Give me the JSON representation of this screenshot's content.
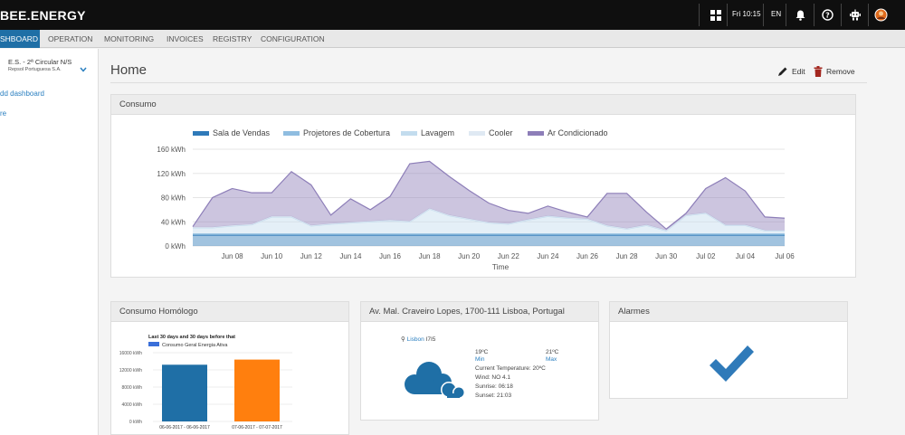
{
  "topbar": {
    "logo": "BEE.ENERGY",
    "datetime": "Fri 10:15",
    "language": "EN",
    "icons": [
      "apps-grid-icon",
      "bell-icon",
      "help-icon",
      "robot-icon",
      "user-avatar-icon"
    ]
  },
  "nav": {
    "items": [
      "DASHBOARD",
      "OPERATION",
      "MONITORING",
      "INVOICES",
      "REGISTRY",
      "CONFIGURATION"
    ],
    "active": "DASHBOARD",
    "dashboard_visible": "SHBOARD"
  },
  "sidebar": {
    "site_name": "E.S. - 2ª Circular N/S",
    "site_company": "Repsol Portuguesa S.A.",
    "add_dashboard": "dd dashboard",
    "more": "re"
  },
  "page": {
    "title": "Home",
    "edit_label": "Edit",
    "remove_label": "Remove"
  },
  "consumo": {
    "title": "Consumo",
    "chart_data": {
      "type": "area",
      "stacked": true,
      "unit": "kWh",
      "xlabel": "Time",
      "ylabel": "",
      "ylim": [
        0,
        160
      ],
      "yticks": [
        "0 kWh",
        "40 kWh",
        "80 kWh",
        "120 kWh",
        "160 kWh"
      ],
      "xticks": [
        "Jun 08",
        "Jun 10",
        "Jun 12",
        "Jun 14",
        "Jun 16",
        "Jun 18",
        "Jun 20",
        "Jun 22",
        "Jun 24",
        "Jun 26",
        "Jun 28",
        "Jun 30",
        "Jul 02",
        "Jul 04",
        "Jul 06"
      ],
      "x": [
        "Jun 06",
        "Jun 07",
        "Jun 08",
        "Jun 09",
        "Jun 10",
        "Jun 11",
        "Jun 12",
        "Jun 13",
        "Jun 14",
        "Jun 15",
        "Jun 16",
        "Jun 17",
        "Jun 18",
        "Jun 19",
        "Jun 20",
        "Jun 21",
        "Jun 22",
        "Jun 23",
        "Jun 24",
        "Jun 25",
        "Jun 26",
        "Jun 27",
        "Jun 28",
        "Jun 29",
        "Jun 30",
        "Jul 01",
        "Jul 02",
        "Jul 03",
        "Jul 04",
        "Jul 05",
        "Jul 06"
      ],
      "series": [
        {
          "name": "Sala de Vendas",
          "color": "#2f7ab9",
          "values": [
            18,
            18,
            18,
            18,
            18,
            18,
            18,
            18,
            18,
            18,
            18,
            18,
            18,
            18,
            18,
            18,
            18,
            18,
            18,
            18,
            18,
            18,
            18,
            18,
            18,
            18,
            18,
            18,
            18,
            18,
            18
          ]
        },
        {
          "name": "Projetores de Cobertura",
          "color": "#8fbde0",
          "values": [
            2,
            2,
            2,
            2,
            2,
            2,
            2,
            2,
            2,
            2,
            2,
            2,
            2,
            2,
            2,
            2,
            2,
            2,
            2,
            2,
            2,
            2,
            2,
            2,
            2,
            2,
            2,
            2,
            2,
            2,
            2
          ]
        },
        {
          "name": "Lavagem",
          "color": "#c3dcee",
          "values": [
            10,
            10,
            13,
            15,
            28,
            28,
            13,
            16,
            18,
            20,
            22,
            20,
            41,
            30,
            24,
            18,
            16,
            23,
            29,
            26,
            24,
            13,
            8,
            14,
            5,
            30,
            34,
            14,
            14,
            5,
            5
          ]
        },
        {
          "name": "Cooler",
          "color": "#dfe9f3",
          "values": [
            1,
            1,
            1,
            1,
            1,
            1,
            1,
            1,
            1,
            1,
            1,
            1,
            1,
            1,
            1,
            1,
            1,
            1,
            1,
            1,
            1,
            1,
            1,
            1,
            1,
            1,
            1,
            1,
            1,
            1,
            1
          ]
        },
        {
          "name": "Ar Condicionado",
          "color": "#8d7eb8",
          "values": [
            1,
            49,
            61,
            52,
            39,
            74,
            67,
            14,
            39,
            19,
            39,
            95,
            78,
            64,
            47,
            32,
            22,
            10,
            16,
            9,
            3,
            53,
            58,
            21,
            2,
            3,
            40,
            78,
            56,
            22,
            20
          ]
        }
      ]
    }
  },
  "homologo": {
    "title": "Consumo Homólogo",
    "chart_data": {
      "type": "bar",
      "title": "Last 30 days and 30 days before that",
      "legend": "Consumo Geral Energia Ativa",
      "categories": [
        "06-06-2017 - 06-06-2017",
        "07-06-2017 - 07-07-2017"
      ],
      "values": [
        13200,
        14400
      ],
      "colors": [
        "#1f6fa6",
        "#ff7f0e"
      ],
      "ylim": [
        0,
        16000
      ],
      "yticks": [
        "0 kWh",
        "4000 kWh",
        "8000 kWh",
        "12000 kWh",
        "16000 kWh"
      ]
    }
  },
  "weather": {
    "title": "Av. Mal. Craveiro Lopes, 1700-111 Lisboa, Portugal",
    "city": "Lisbon",
    "code": "I7I5",
    "min_temp": "19ºC",
    "max_temp": "21ºC",
    "min_label": "Min",
    "max_label": "Max",
    "current": "Current Temperature:  20ºC",
    "wind": "Wind:  NO 4.1",
    "sunrise": "Sunrise:  06:18",
    "sunset": "Sunset:  21:03"
  },
  "alarmes": {
    "title": "Alarmes",
    "status_icon": "checkmark-icon",
    "color": "#2f7ab9"
  }
}
